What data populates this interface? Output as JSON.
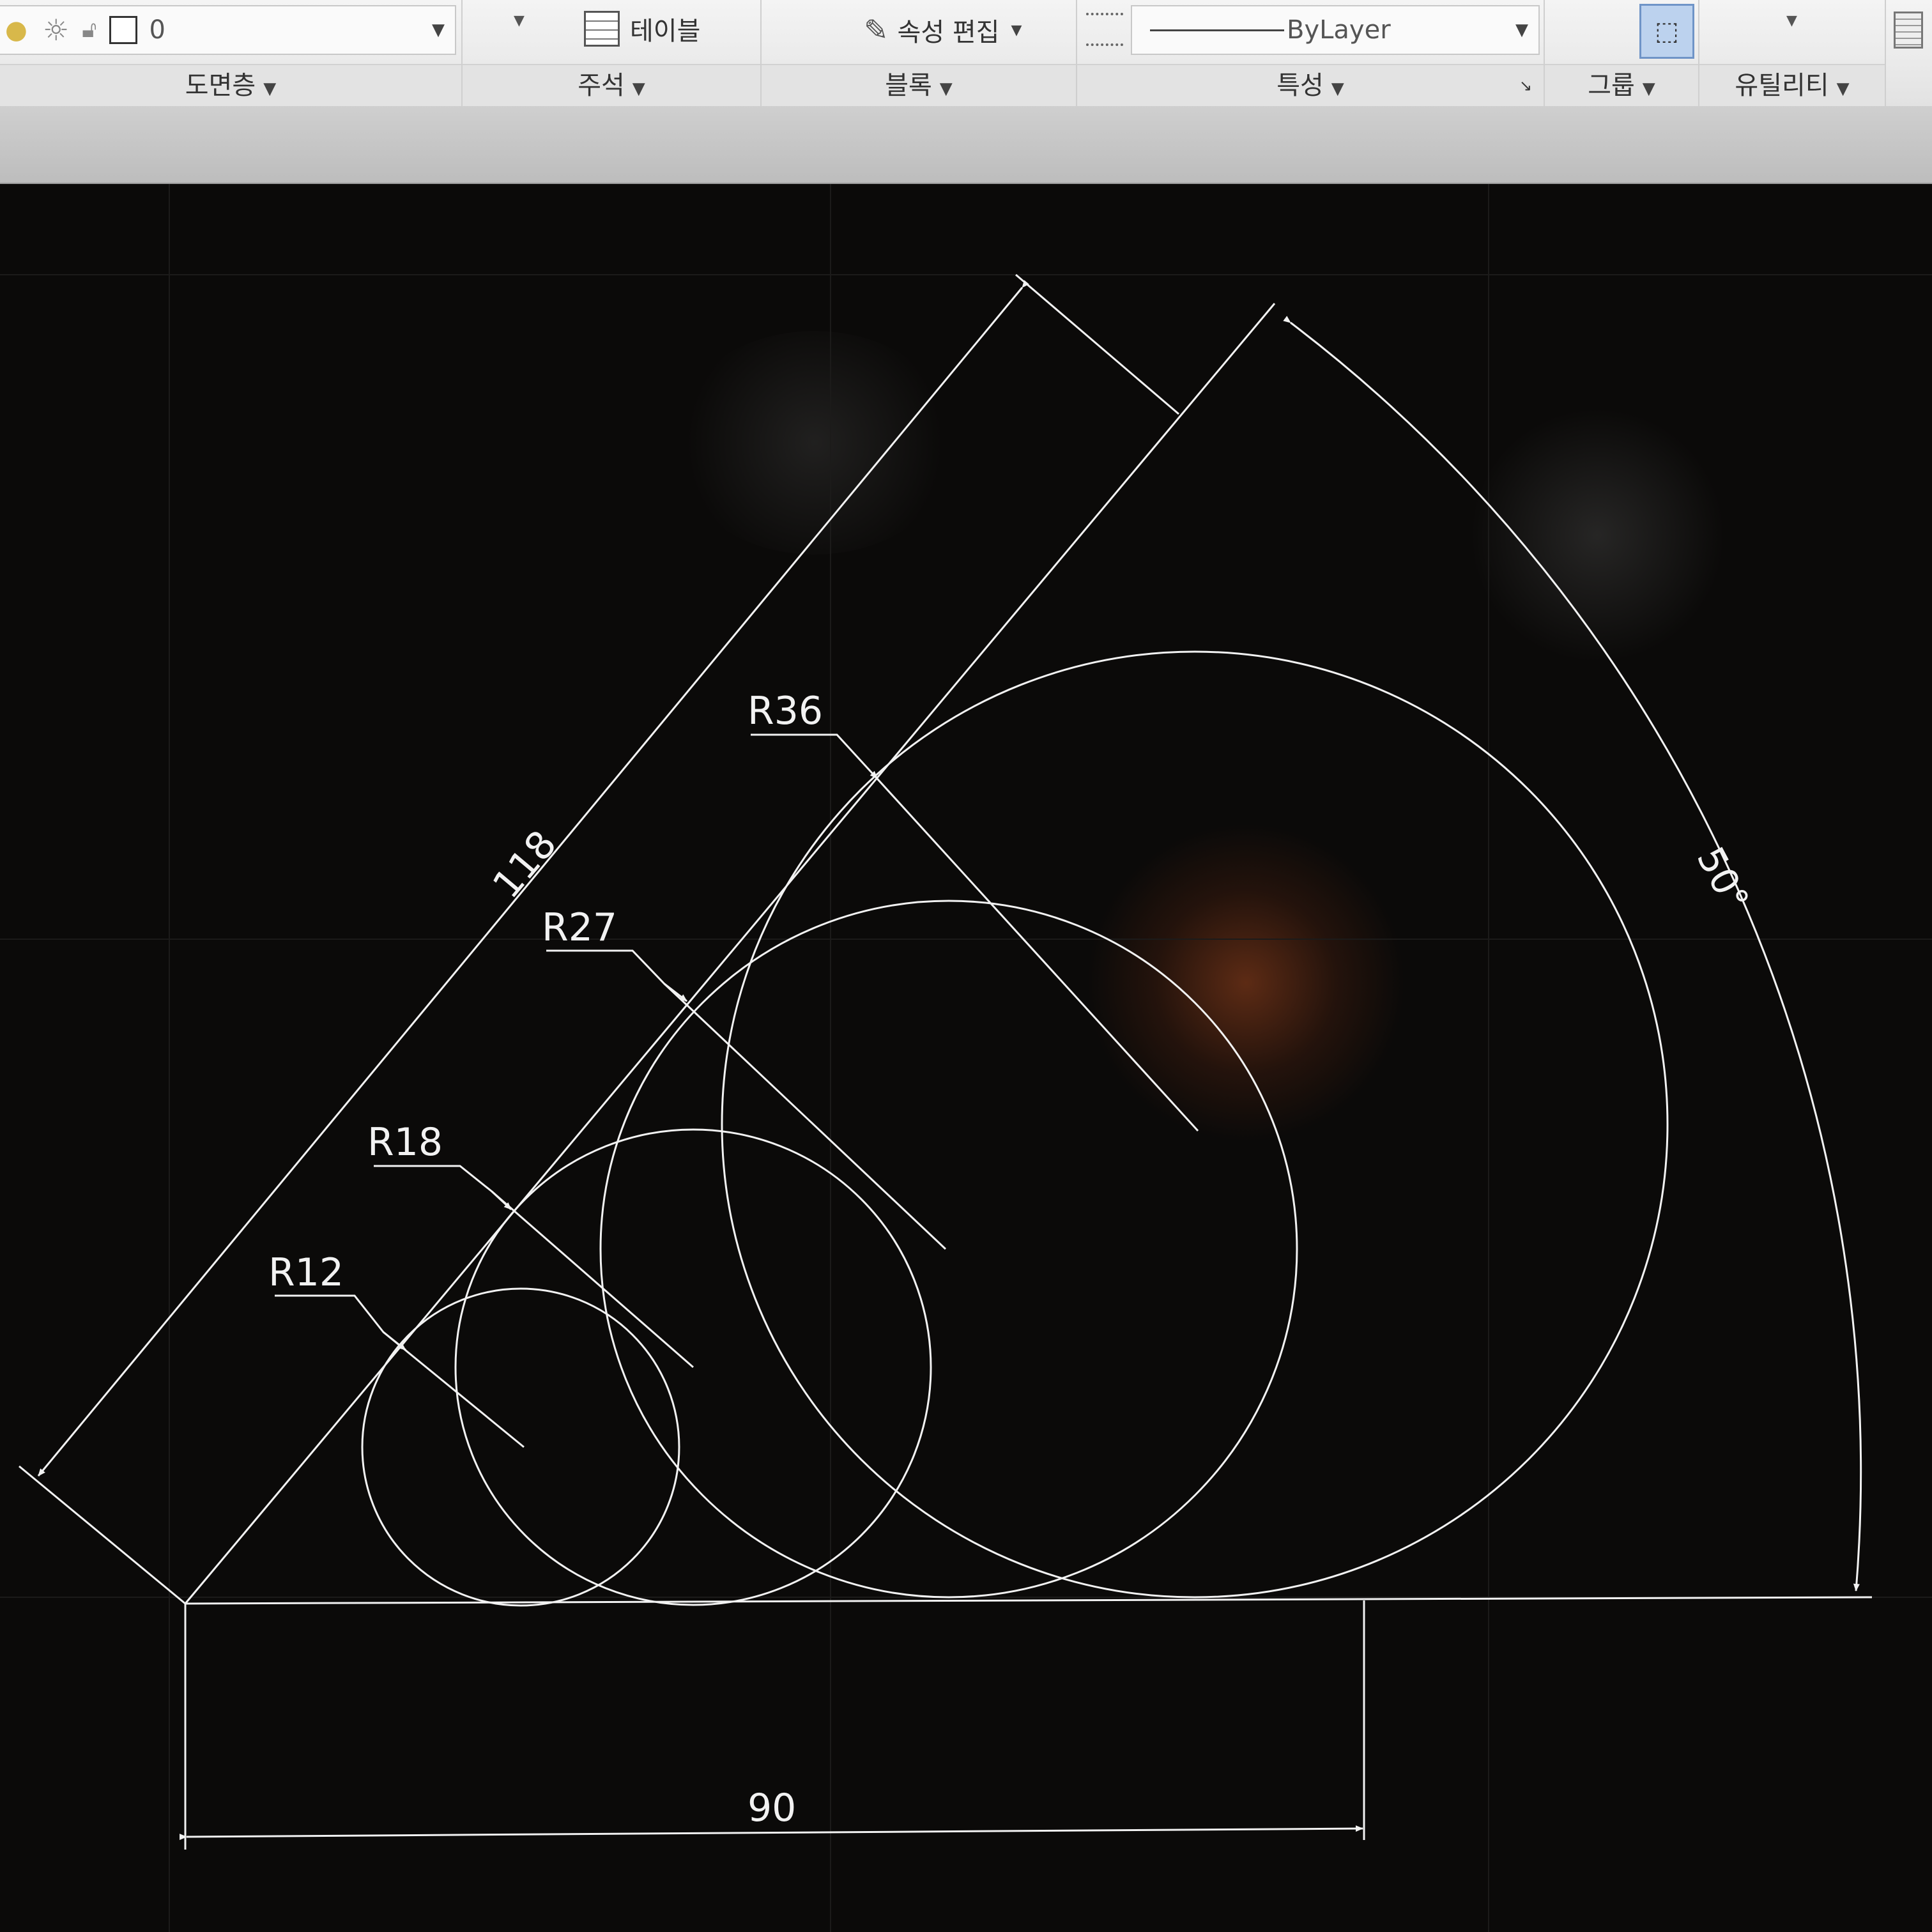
{
  "ribbon": {
    "layer": {
      "current": "0",
      "panel_label": "도면층"
    },
    "annotation": {
      "table_label": "테이블",
      "panel_label": "주석"
    },
    "block": {
      "edit_attr_label": "속성 편집",
      "panel_label": "블록"
    },
    "properties": {
      "linetype_value": "ByLayer",
      "panel_label": "특성"
    },
    "groups": {
      "panel_label": "그룹"
    },
    "utilities": {
      "panel_label": "유틸리티"
    }
  },
  "drawing": {
    "line_color": "#f2f2f2",
    "background": "#0b0a09",
    "dimensions": {
      "radius_small": "R12",
      "radius_med": "R18",
      "radius_large": "R27",
      "radius_xlarge": "R36",
      "aligned_length": "118",
      "base_length": "90",
      "angle": "50°"
    }
  }
}
